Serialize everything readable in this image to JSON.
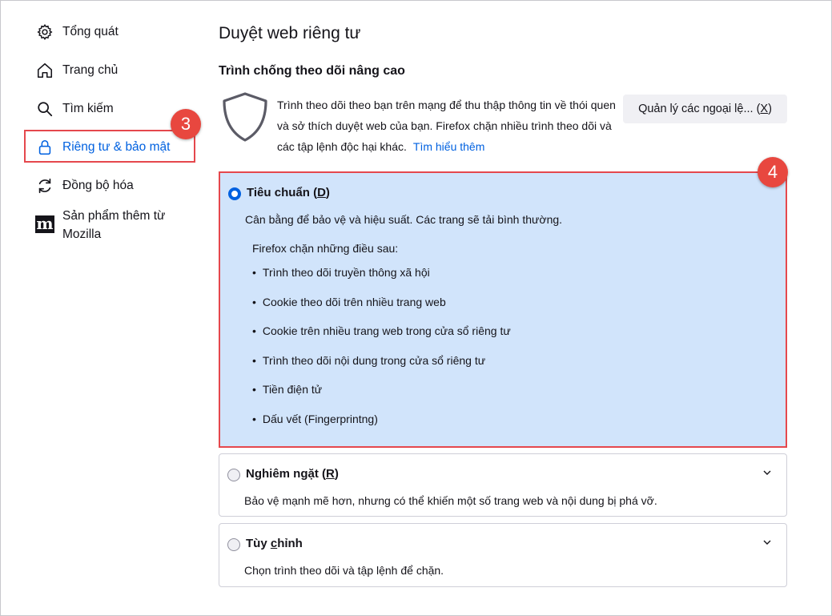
{
  "sidebar": {
    "items": [
      {
        "label": "Tổng quát",
        "icon": "gear-icon"
      },
      {
        "label": "Trang chủ",
        "icon": "home-icon"
      },
      {
        "label": "Tìm kiếm",
        "icon": "search-icon"
      },
      {
        "label": "Riêng tư & bảo mật",
        "icon": "lock-icon",
        "selected": true
      },
      {
        "label": "Đồng bộ hóa",
        "icon": "sync-icon"
      },
      {
        "label": "Sản phẩm thêm từ Mozilla",
        "icon": "mozilla-icon"
      }
    ]
  },
  "badges": {
    "sidebar": "3",
    "main": "4"
  },
  "main": {
    "page_title": "Duyệt web riêng tư",
    "section_title": "Trình chống theo dõi nâng cao",
    "description": "Trình theo dõi theo bạn trên mạng để thu thập thông tin về thói quen và sở thích duyệt web của bạn. Firefox chặn nhiều trình theo dõi và các tập lệnh độc hại khác.",
    "learn_more": "Tìm hiểu thêm",
    "manage_button": {
      "label": "Quản lý các ngoại lệ...",
      "shortcut": "X"
    },
    "options": [
      {
        "title": "Tiêu chuẩn",
        "shortcut": "D",
        "subtitle": "Cân bằng để bảo vệ và hiệu suất. Các trang sẽ tải bình thường.",
        "selected": true,
        "blocks_title": "Firefox chặn những điều sau:",
        "blocks": [
          "Trình theo dõi truyền thông xã hội",
          "Cookie theo dõi trên nhiều trang web",
          "Cookie trên nhiều trang web trong cửa sổ riêng tư",
          "Trình theo dõi nội dung trong cửa sổ riêng tư",
          "Tiền điện tử",
          "Dấu vết (Fingerprintng)"
        ]
      },
      {
        "title": "Nghiêm ngặt",
        "shortcut": "R",
        "subtitle": "Bảo vệ mạnh mẽ hơn, nhưng có thể khiến một số trang web và nội dung bị phá vỡ.",
        "selected": false
      },
      {
        "title_prefix": "Tùy ",
        "title_accel": "c",
        "title_suffix": "hỉnh",
        "subtitle": "Chọn trình theo dõi và tập lệnh để chặn.",
        "selected": false
      }
    ]
  },
  "colors": {
    "accent": "#0061e0",
    "highlight": "#e5484d",
    "selected_bg": "#d1e4fb"
  }
}
